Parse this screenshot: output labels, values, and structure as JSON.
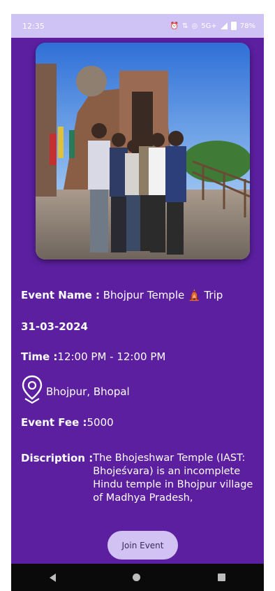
{
  "status_bar": {
    "time": "12:35",
    "icons": [
      "alarm-icon",
      "data-icon",
      "hotspot-icon",
      "signal-icon",
      "battery-icon"
    ],
    "network": "5G+",
    "battery": "78%"
  },
  "event": {
    "image_alt": "Group photo at Bhojpur Temple",
    "name_label": "Event Name :",
    "name_value": "Bhojpur Temple 🛕 Trip",
    "date": "31-03-2024",
    "time_label": "Time :",
    "time_value": "12:00 PM - 12:00 PM",
    "location": "Bhojpur, Bhopal",
    "fee_label": "Event Fee :",
    "fee_value": "5000",
    "description_label": "Discription :",
    "description_value": "The Bhojeshwar Temple (IAST: Bhojeśvara) is an incomplete Hindu temple in Bhojpur village of Madhya Pradesh,"
  },
  "actions": {
    "join_label": "Join Event"
  },
  "colors": {
    "background": "#5b1fa0",
    "status_bar": "#cfc2f5",
    "button": "#d2c1f3",
    "nav_bar": "#0a0a0a"
  }
}
